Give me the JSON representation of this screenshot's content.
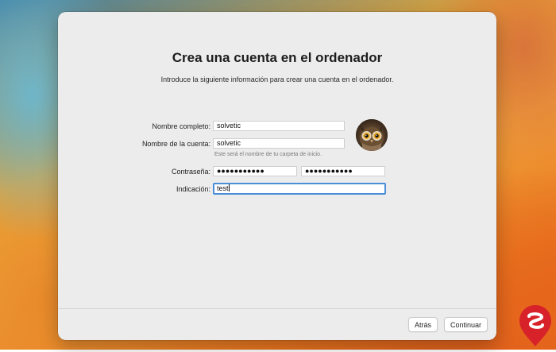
{
  "dialog": {
    "title": "Crea una cuenta en el ordenador",
    "subtitle": "Introduce la siguiente información para crear una cuenta en el ordenador."
  },
  "form": {
    "full_name": {
      "label": "Nombre completo:",
      "value": "solvetic"
    },
    "account_name": {
      "label": "Nombre de la cuenta:",
      "value": "solvetic",
      "help": "Este será el nombre de tu carpeta de inicio."
    },
    "password": {
      "label": "Contraseña:",
      "value": "●●●●●●●●●●●",
      "verify_value": "●●●●●●●●●●●"
    },
    "hint": {
      "label": "Indicación:",
      "value": "test"
    }
  },
  "avatar": {
    "icon": "owl-avatar"
  },
  "buttons": {
    "back": "Atrás",
    "continue": "Continuar"
  },
  "colors": {
    "window_bg": "#ececec",
    "focus_ring": "#4a8ed9",
    "logo_red": "#d8222a"
  }
}
